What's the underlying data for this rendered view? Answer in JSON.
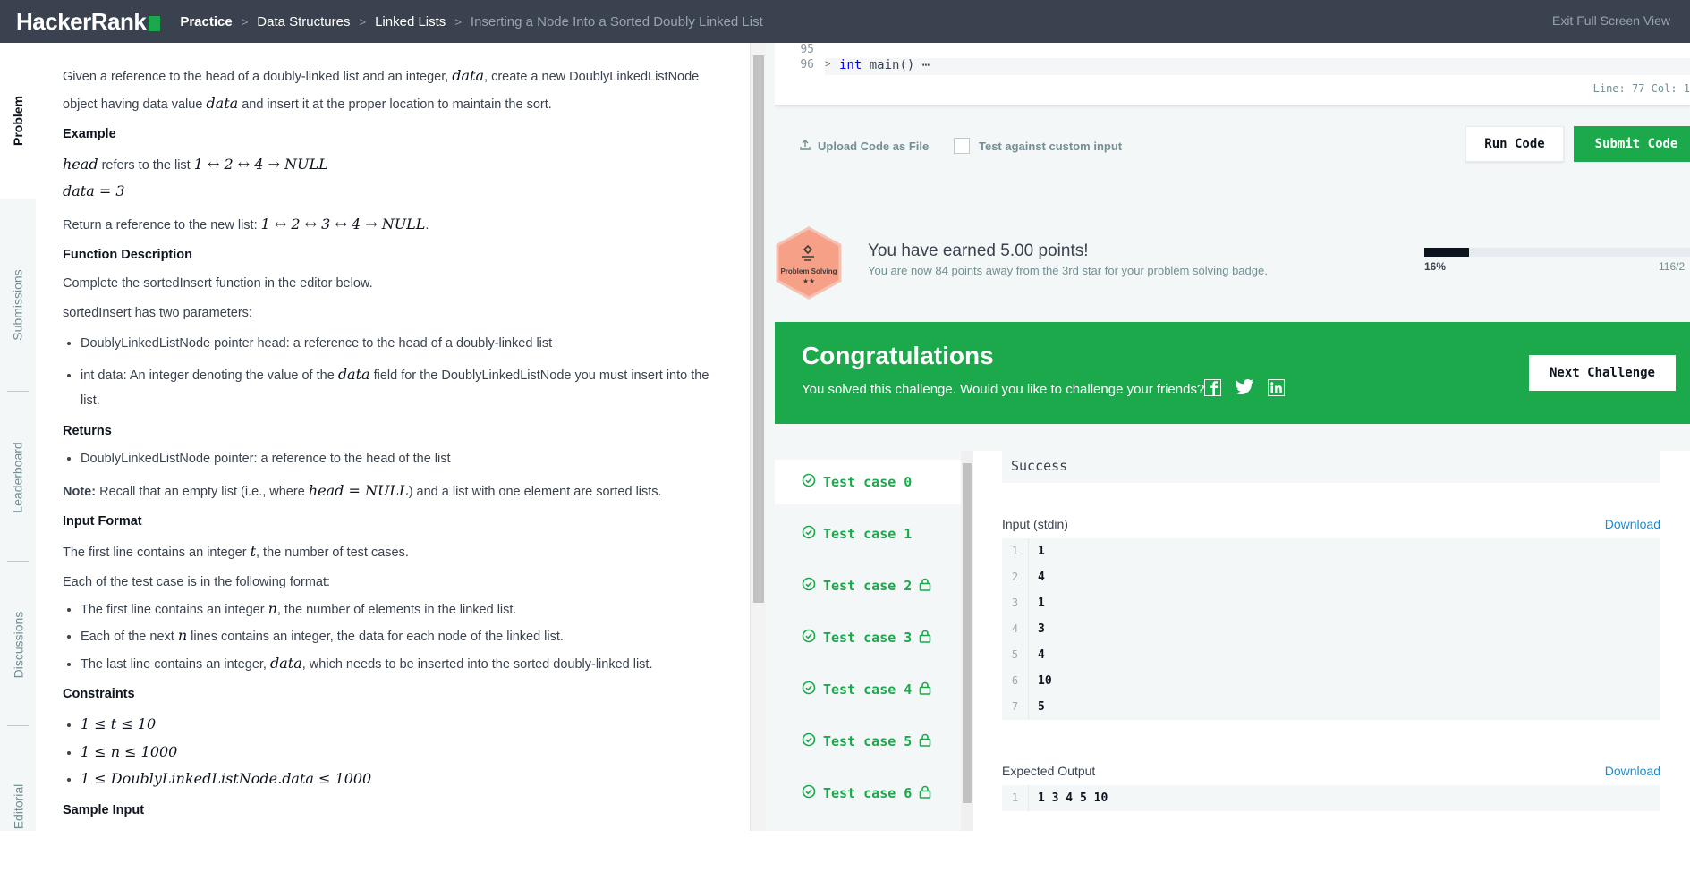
{
  "header": {
    "logo": "HackerRank",
    "breadcrumbs": [
      "Practice",
      "Data Structures",
      "Linked Lists",
      "Inserting a Node Into a Sorted Doubly Linked List"
    ],
    "exit_fullscreen": "Exit Full Screen View"
  },
  "sidebar": {
    "tabs": [
      {
        "label": "Problem"
      },
      {
        "label": "Submissions"
      },
      {
        "label": "Leaderboard"
      },
      {
        "label": "Discussions"
      },
      {
        "label": "Editorial"
      }
    ]
  },
  "problem": {
    "intro_1": "Given a reference to the head of a doubly-linked list and an integer, ",
    "intro_var_data": "data",
    "intro_2": ", create a new DoublyLinkedListNode object having data value ",
    "intro_3": " and insert it at the proper location to maintain the sort.",
    "example_heading": "Example",
    "example_head_var": "head",
    "example_head_text": " refers to the list ",
    "example_head_list": "1 ↔ 2 ↔ 4 → NULL",
    "example_data": "data = 3",
    "example_return_text": "Return a reference to the new list: ",
    "example_return_list": "1 ↔ 2 ↔ 3 ↔ 4 → NULL",
    "function_heading": "Function Description",
    "function_desc": "Complete the sortedInsert function in the editor below.",
    "params_intro": "sortedInsert has two parameters:",
    "param_1": "DoublyLinkedListNode pointer head: a reference to the head of a doubly-linked list",
    "param_2_a": "int data: An integer denoting the value of the ",
    "param_2_var": "data",
    "param_2_b": " field for the DoublyLinkedListNode you must insert into the list.",
    "returns_heading": "Returns",
    "returns_1": "DoublyLinkedListNode pointer: a reference to the head of the list",
    "note_label": "Note:",
    "note_a": " Recall that an empty list (i.e., where ",
    "note_var": "head = NULL",
    "note_b": ") and a list with one element are sorted lists.",
    "input_heading": "Input Format",
    "input_line_a": "The first line contains an integer ",
    "input_line_var": "t",
    "input_line_b": ", the number of test cases.",
    "format_intro": "Each of the test case is in the following format:",
    "format_1_a": "The first line contains an integer ",
    "format_1_var": "n",
    "format_1_b": ", the number of elements in the linked list.",
    "format_2_a": "Each of the next ",
    "format_2_var": "n",
    "format_2_b": " lines contains an integer, the data for each node of the linked list.",
    "format_3_a": "The last line contains an integer, ",
    "format_3_var": "data",
    "format_3_b": ", which needs to be inserted into the sorted doubly-linked list.",
    "constraints_heading": "Constraints",
    "constraint_1": "1 ≤ t ≤ 10",
    "constraint_2": "1 ≤ n ≤ 1000",
    "constraint_3": "1 ≤ DoublyLinkedListNode.data ≤ 1000",
    "sample_heading": "Sample Input"
  },
  "editor": {
    "line_95": "95",
    "line_96": "96",
    "code_keyword": "int",
    "code_rest": " main() ⋯",
    "status": "Line: 77 Col: 1"
  },
  "actions": {
    "upload": "Upload Code as File",
    "custom_input": "Test against custom input",
    "run": "Run Code",
    "submit": "Submit Code"
  },
  "badge": {
    "label": "Problem Solving",
    "stars": "★★",
    "earned": "You have earned 5.00 points!",
    "away": "You are now 84 points away from the 3rd star for your problem solving badge.",
    "progress_percent": 16,
    "progress_label": "16%",
    "points_label": "116/2"
  },
  "congrats": {
    "title": "Congratulations",
    "message": "You solved this challenge. Would you like to challenge your friends?",
    "next": "Next Challenge"
  },
  "testcases": [
    {
      "label": "Test case 0",
      "locked": false
    },
    {
      "label": "Test case 1",
      "locked": false
    },
    {
      "label": "Test case 2",
      "locked": true
    },
    {
      "label": "Test case 3",
      "locked": true
    },
    {
      "label": "Test case 4",
      "locked": true
    },
    {
      "label": "Test case 5",
      "locked": true
    },
    {
      "label": "Test case 6",
      "locked": true
    }
  ],
  "result": {
    "status": "Success",
    "input_label": "Input (stdin)",
    "download": "Download",
    "input_lines": [
      {
        "n": "1",
        "v": "1"
      },
      {
        "n": "2",
        "v": "4"
      },
      {
        "n": "3",
        "v": "1"
      },
      {
        "n": "4",
        "v": "3"
      },
      {
        "n": "5",
        "v": "4"
      },
      {
        "n": "6",
        "v": "10"
      },
      {
        "n": "7",
        "v": "5"
      }
    ],
    "expected_label": "Expected Output",
    "expected_lines": [
      {
        "n": "1",
        "v": "1 3 4 5 10"
      }
    ]
  },
  "colors": {
    "accent": "#1ba94c",
    "header_bg": "#39424e",
    "link": "#1f8acb",
    "badge": "#f7a088"
  }
}
